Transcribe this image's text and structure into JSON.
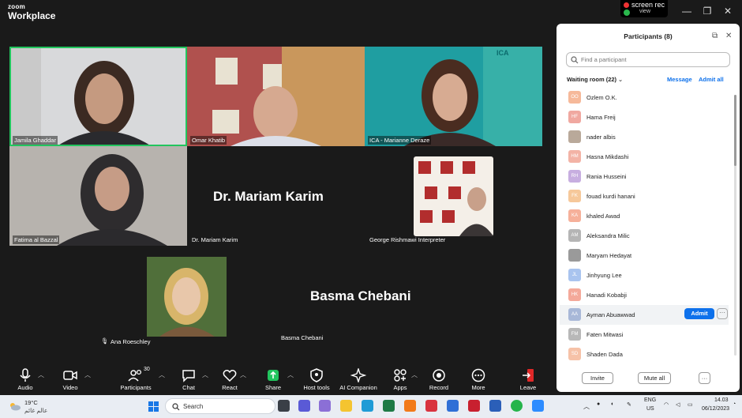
{
  "app": {
    "logo_line1": "zoom",
    "logo_line2": "Workplace"
  },
  "recorder": {
    "title": "screen rec",
    "subtitle": "view"
  },
  "window_controls": {
    "minimize": "—",
    "restore": "❐",
    "close": "✕"
  },
  "video_tiles": [
    {
      "name": "Jamila Ghaddar",
      "active": true
    },
    {
      "name": "Omar Khatib"
    },
    {
      "name": "ICA - Marianne Deraze",
      "logo_text": "ICA"
    },
    {
      "name": "Fatima al Bazzal"
    },
    {
      "name": "Dr. Mariam Karim",
      "display": "Dr. Mariam Karim"
    },
    {
      "name": "George Rishmawi Interpreter"
    },
    {
      "name": "Ana Roeschley"
    },
    {
      "name": "Basma Chebani",
      "display": "Basma Chebani"
    }
  ],
  "toolbar": {
    "audio": "Audio",
    "video": "Video",
    "participants": "Participants",
    "participants_count": "30",
    "chat": "Chat",
    "react": "React",
    "share": "Share",
    "host_tools": "Host tools",
    "ai_companion": "AI Companion",
    "apps": "Apps",
    "record": "Record",
    "more": "More",
    "leave": "Leave"
  },
  "panel": {
    "title": "Participants (8)",
    "search_placeholder": "Find a participant",
    "waiting_room": "Waiting room (22)",
    "message": "Message",
    "admit_all": "Admit all",
    "admit": "Admit",
    "more": "···",
    "invite": "Invite",
    "mute_all": "Mute all",
    "footer_more": "···",
    "waiting": [
      {
        "initials": "OO",
        "name": "Ozlem O.K.",
        "color": "#f6b99a"
      },
      {
        "initials": "HF",
        "name": "Hama Freij",
        "color": "#f0a8a0"
      },
      {
        "initials": "",
        "name": "nader albis",
        "color": "#b9a99a"
      },
      {
        "initials": "HM",
        "name": "Hasna Mikdashi",
        "color": "#f3b3a6"
      },
      {
        "initials": "RH",
        "name": "Rania Husseini",
        "color": "#c7aee0"
      },
      {
        "initials": "FK",
        "name": "fouad kurdi hanani",
        "color": "#f6c89a"
      },
      {
        "initials": "KA",
        "name": "khaled Awad",
        "color": "#f6b09a"
      },
      {
        "initials": "AM",
        "name": "Aleksandra Milic",
        "color": "#b5b5b5"
      },
      {
        "initials": "",
        "name": "Maryam Hedayat",
        "color": "#9a9a9a"
      },
      {
        "initials": "JL",
        "name": "Jinhyung Lee",
        "color": "#a9c4ef"
      },
      {
        "initials": "HK",
        "name": "Hanadi Kobabji",
        "color": "#f4a99a"
      },
      {
        "initials": "AA",
        "name": "Ayman Abuawwad",
        "color": "#a8b8d8"
      },
      {
        "initials": "FM",
        "name": "Faten Mitwasi",
        "color": "#b8b8b8"
      },
      {
        "initials": "SD",
        "name": "Shaden Dada",
        "color": "#f6c2a8"
      }
    ]
  },
  "taskbar": {
    "temp": "19°C",
    "weather": "عالم غائم",
    "search": "Search",
    "lang1": "ENG",
    "lang2": "US",
    "time": "14.03",
    "date": "06/12/2023"
  }
}
